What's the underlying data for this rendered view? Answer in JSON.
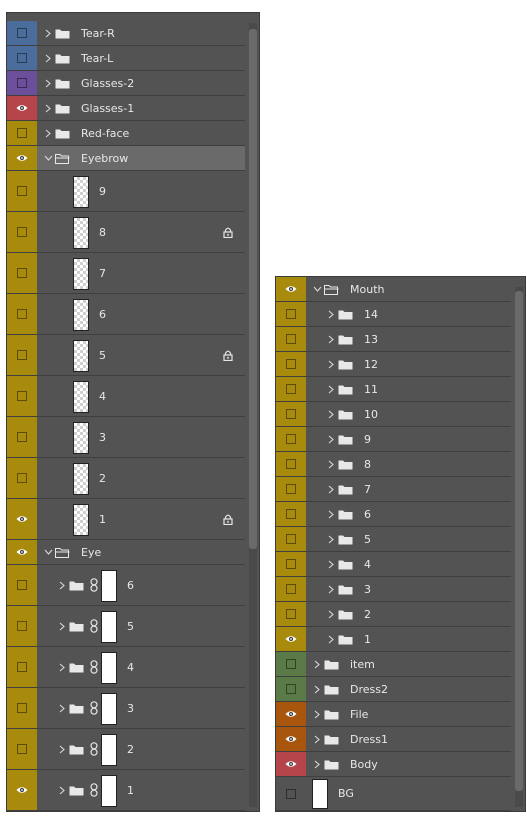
{
  "colors": {
    "panel_bg": "#535353",
    "row_divider": "#3f3f3f",
    "selected_row": "#6a6a6a",
    "tag_blue": "#4a6d9c",
    "tag_violet": "#6c4f9a",
    "tag_red": "#b5444b",
    "tag_yellow": "#a88a0d",
    "tag_green": "#5a7a48",
    "tag_orange": "#a8560d"
  },
  "left_panel": {
    "layers": [
      {
        "name": "Tear-R",
        "kind": "group",
        "expanded": false,
        "visible": false,
        "color": "blue",
        "depth": 0
      },
      {
        "name": "Tear-L",
        "kind": "group",
        "expanded": false,
        "visible": false,
        "color": "blue",
        "depth": 0
      },
      {
        "name": "Glasses-2",
        "kind": "group",
        "expanded": false,
        "visible": false,
        "color": "violet",
        "depth": 0
      },
      {
        "name": "Glasses-1",
        "kind": "group",
        "expanded": false,
        "visible": true,
        "color": "red",
        "depth": 0
      },
      {
        "name": "Red-face",
        "kind": "group",
        "expanded": false,
        "visible": false,
        "color": "yellow",
        "depth": 0
      },
      {
        "name": "Eyebrow",
        "kind": "group",
        "expanded": true,
        "visible": true,
        "color": "yellow",
        "depth": 0,
        "selected": true
      },
      {
        "name": "9",
        "kind": "layer",
        "visible": false,
        "color": "yellow",
        "depth": 1,
        "thumb": "checker",
        "locked": false
      },
      {
        "name": "8",
        "kind": "layer",
        "visible": false,
        "color": "yellow",
        "depth": 1,
        "thumb": "checker",
        "locked": true
      },
      {
        "name": "7",
        "kind": "layer",
        "visible": false,
        "color": "yellow",
        "depth": 1,
        "thumb": "checker",
        "locked": false
      },
      {
        "name": "6",
        "kind": "layer",
        "visible": false,
        "color": "yellow",
        "depth": 1,
        "thumb": "checker",
        "locked": false
      },
      {
        "name": "5",
        "kind": "layer",
        "visible": false,
        "color": "yellow",
        "depth": 1,
        "thumb": "checker",
        "locked": true
      },
      {
        "name": "4",
        "kind": "layer",
        "visible": false,
        "color": "yellow",
        "depth": 1,
        "thumb": "checker",
        "locked": false
      },
      {
        "name": "3",
        "kind": "layer",
        "visible": false,
        "color": "yellow",
        "depth": 1,
        "thumb": "checker",
        "locked": false
      },
      {
        "name": "2",
        "kind": "layer",
        "visible": false,
        "color": "yellow",
        "depth": 1,
        "thumb": "checker",
        "locked": false
      },
      {
        "name": "1",
        "kind": "layer",
        "visible": true,
        "color": "yellow",
        "depth": 1,
        "thumb": "checker",
        "locked": true
      },
      {
        "name": "Eye",
        "kind": "group",
        "expanded": true,
        "visible": true,
        "color": "yellow",
        "depth": 0
      },
      {
        "name": "6",
        "kind": "masked-group",
        "visible": false,
        "color": "yellow",
        "depth": 1
      },
      {
        "name": "5",
        "kind": "masked-group",
        "visible": false,
        "color": "yellow",
        "depth": 1
      },
      {
        "name": "4",
        "kind": "masked-group",
        "visible": false,
        "color": "yellow",
        "depth": 1
      },
      {
        "name": "3",
        "kind": "masked-group",
        "visible": false,
        "color": "yellow",
        "depth": 1
      },
      {
        "name": "2",
        "kind": "masked-group",
        "visible": false,
        "color": "yellow",
        "depth": 1
      },
      {
        "name": "1",
        "kind": "masked-group",
        "visible": true,
        "color": "yellow",
        "depth": 1
      }
    ]
  },
  "right_panel": {
    "layers": [
      {
        "name": "Mouth",
        "kind": "group",
        "expanded": true,
        "visible": true,
        "color": "yellow",
        "depth": 0
      },
      {
        "name": "14",
        "kind": "group",
        "expanded": false,
        "visible": false,
        "color": "yellow",
        "depth": 1
      },
      {
        "name": "13",
        "kind": "group",
        "expanded": false,
        "visible": false,
        "color": "yellow",
        "depth": 1
      },
      {
        "name": "12",
        "kind": "group",
        "expanded": false,
        "visible": false,
        "color": "yellow",
        "depth": 1
      },
      {
        "name": "11",
        "kind": "group",
        "expanded": false,
        "visible": false,
        "color": "yellow",
        "depth": 1
      },
      {
        "name": "10",
        "kind": "group",
        "expanded": false,
        "visible": false,
        "color": "yellow",
        "depth": 1
      },
      {
        "name": "9",
        "kind": "group",
        "expanded": false,
        "visible": false,
        "color": "yellow",
        "depth": 1
      },
      {
        "name": "8",
        "kind": "group",
        "expanded": false,
        "visible": false,
        "color": "yellow",
        "depth": 1
      },
      {
        "name": "7",
        "kind": "group",
        "expanded": false,
        "visible": false,
        "color": "yellow",
        "depth": 1
      },
      {
        "name": "6",
        "kind": "group",
        "expanded": false,
        "visible": false,
        "color": "yellow",
        "depth": 1
      },
      {
        "name": "5",
        "kind": "group",
        "expanded": false,
        "visible": false,
        "color": "yellow",
        "depth": 1
      },
      {
        "name": "4",
        "kind": "group",
        "expanded": false,
        "visible": false,
        "color": "yellow",
        "depth": 1
      },
      {
        "name": "3",
        "kind": "group",
        "expanded": false,
        "visible": false,
        "color": "yellow",
        "depth": 1
      },
      {
        "name": "2",
        "kind": "group",
        "expanded": false,
        "visible": false,
        "color": "yellow",
        "depth": 1
      },
      {
        "name": "1",
        "kind": "group",
        "expanded": false,
        "visible": true,
        "color": "yellow",
        "depth": 1
      },
      {
        "name": "item",
        "kind": "group",
        "expanded": false,
        "visible": false,
        "color": "green",
        "depth": 0
      },
      {
        "name": "Dress2",
        "kind": "group",
        "expanded": false,
        "visible": false,
        "color": "green",
        "depth": 0
      },
      {
        "name": "File",
        "kind": "group",
        "expanded": false,
        "visible": true,
        "color": "orange",
        "depth": 0
      },
      {
        "name": "Dress1",
        "kind": "group",
        "expanded": false,
        "visible": true,
        "color": "orange",
        "depth": 0
      },
      {
        "name": "Body",
        "kind": "group",
        "expanded": false,
        "visible": true,
        "color": "red",
        "depth": 0
      },
      {
        "name": "BG",
        "kind": "layer",
        "visible": false,
        "color": "none",
        "depth": 0,
        "thumb": "white",
        "locked": false
      }
    ]
  }
}
